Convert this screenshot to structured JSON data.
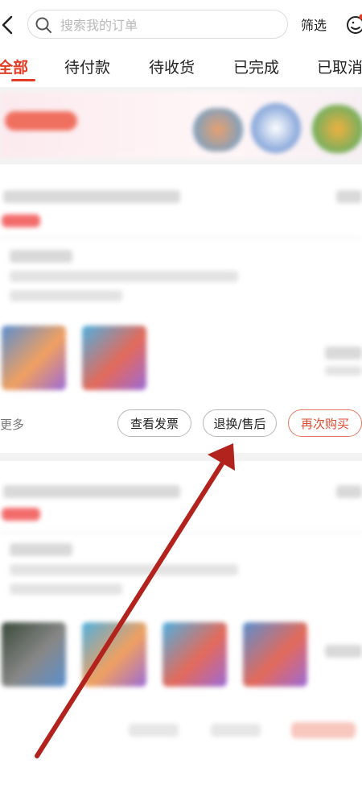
{
  "header": {
    "search_placeholder": "搜索我的订单",
    "filter_label": "筛选"
  },
  "tabs": [
    {
      "label": "全部",
      "active": true
    },
    {
      "label": "待付款",
      "active": false
    },
    {
      "label": "待收货",
      "active": false
    },
    {
      "label": "已完成",
      "active": false
    },
    {
      "label": "已取消",
      "active": false
    }
  ],
  "order": {
    "more_label": "更多",
    "actions": [
      {
        "label": "查看发票"
      },
      {
        "label": "退换/售后"
      },
      {
        "label": "再次购买"
      }
    ]
  },
  "colors": {
    "accent": "#e33c24",
    "annotation_arrow": "#b3231d"
  },
  "icons": [
    "chevron-left-icon",
    "search-icon",
    "customer-service-icon",
    "red-dot-badge-icon"
  ]
}
